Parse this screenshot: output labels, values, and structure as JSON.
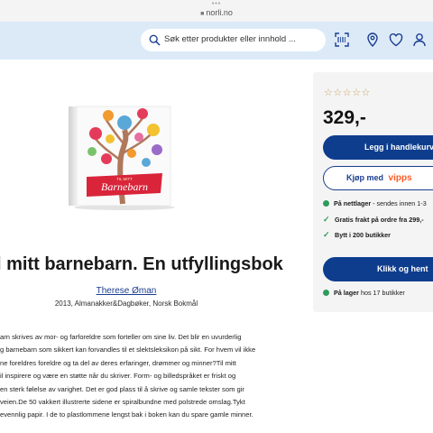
{
  "browser": {
    "dots": "•••",
    "url": "norli.no"
  },
  "header": {
    "search_placeholder": "Søk etter produkter eller innhold ...",
    "icons": [
      "barcode-scanner-icon",
      "location-pin-icon",
      "heart-icon",
      "user-icon"
    ]
  },
  "product": {
    "cover": {
      "subtitle": "TIL MITT",
      "title": "Barnebarn"
    },
    "title": "l mitt barnebarn. En utfyllingsbok",
    "author": "Therese Øman",
    "meta": "2013, Almanakker&Dagbøker, Norsk Bokmål",
    "description": [
      "arn skrives av mor- og farforeldre som forteller om sine liv. Det blir en uvurderlig",
      "g barnebarn som sikkert kan forvandles til et slektsleksikon på sikt. For hvem vil ikke",
      "ne foreldres foreldre og ta del av deres erfaringer, drømmer og minner?Til mitt",
      "il inspirere og være en støtte når du skriver. Form- og billedspråket er friskt og",
      "en sterk følelse av varighet. Det er god plass til å skrive og samle tekster som gir",
      "veien.De 50 vakkert illustrerte sidene er spiralbundne med polstrede omslag.Tykt",
      "evennlig papir. I de to plastlommene lengst bak i boken kan du spare gamle minner."
    ]
  },
  "panel": {
    "rating_stars": "☆☆☆☆☆",
    "price": "329,-",
    "add_to_cart": "Legg i handlekurv",
    "vipps_prefix": "Kjøp med",
    "vipps_brand": "vipps",
    "online_label": "På nettlager",
    "online_detail": "- sendes innen 1-3",
    "free_shipping": "Gratis frakt på ordre fra 299,-",
    "stores": "Bytt i 200 butikker",
    "click_collect": "Klikk og hent",
    "in_stock_label": "På lager",
    "in_stock_detail": "hos 17 butikker",
    "colors": {
      "primary": "#0e3d8e",
      "success": "#2e9b5c",
      "vipps": "#ff5b24",
      "header": "#dceaf8"
    }
  }
}
